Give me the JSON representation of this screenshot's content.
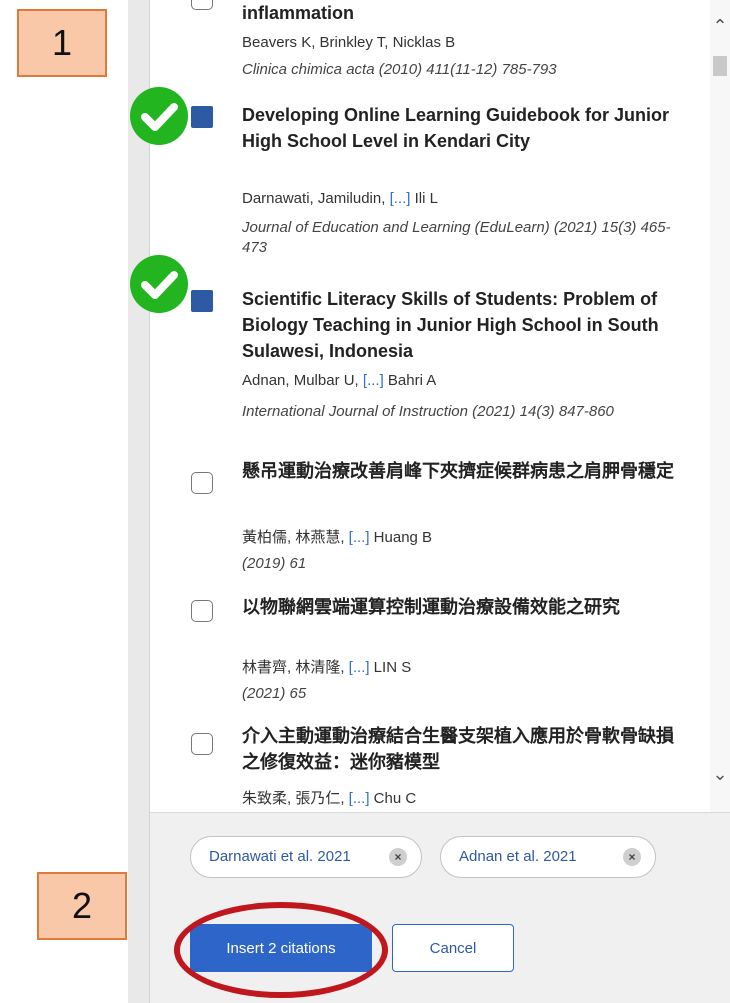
{
  "items": [
    {
      "title": "inflammation",
      "authors": "Beavers K, Brinkley T, Nicklas B",
      "authors_more": "",
      "journal": "Clinica chimica acta (2010) 411(11-12) 785-793",
      "checked": false
    },
    {
      "title": "Developing Online Learning Guidebook for Junior High School Level in Kendari City",
      "authors_pre": "Darnawati, Jamiludin, ",
      "authors_more": "[...]",
      "authors_post": " Ili L",
      "journal": "Journal of Education and Learning (EduLearn) (2021) 15(3) 465-473",
      "checked": true
    },
    {
      "title": "Scientific Literacy Skills of Students: Problem of Biology Teaching in Junior High School in South Sulawesi, Indonesia",
      "authors_pre": "Adnan, Mulbar U, ",
      "authors_more": "[...]",
      "authors_post": " Bahri A",
      "journal": "International Journal of Instruction (2021) 14(3) 847-860",
      "checked": true
    },
    {
      "title": "懸吊運動治療改善肩峰下夾擠症候群病患之肩胛骨穩定",
      "authors_pre": "黃柏儒, 林燕慧, ",
      "authors_more": "[...]",
      "authors_post": " Huang B",
      "journal": "(2019) 61",
      "checked": false
    },
    {
      "title": "以物聯網雲端運算控制運動治療設備效能之研究",
      "authors_pre": "林書齊, 林清隆, ",
      "authors_more": "[...]",
      "authors_post": " LIN S",
      "journal": "(2021) 65",
      "checked": false
    },
    {
      "title": "介入主動運動治療結合生醫支架植入應用於骨軟骨缺損之修復效益：迷你豬模型",
      "authors_pre": "朱致柔, 張乃仁, ",
      "authors_more": "[...]",
      "authors_post": " Chu C",
      "journal": "",
      "checked": false
    }
  ],
  "chips": [
    {
      "label": "Darnawati et al. 2021",
      "remove": "×"
    },
    {
      "label": "Adnan et al. 2021",
      "remove": "×"
    }
  ],
  "buttons": {
    "insert": "Insert 2 citations",
    "cancel": "Cancel"
  },
  "annotations": {
    "step1": "1",
    "step2": "2"
  },
  "icons": {
    "check": "checkmark-icon",
    "scroll_up": "chevron-up-icon",
    "scroll_down": "chevron-down-icon",
    "remove": "close-icon"
  },
  "colors": {
    "accent": "#2d66c8",
    "check_green": "#22b51f",
    "annotation_red": "#c0161e",
    "annotation_box": "#f8c8a8"
  }
}
